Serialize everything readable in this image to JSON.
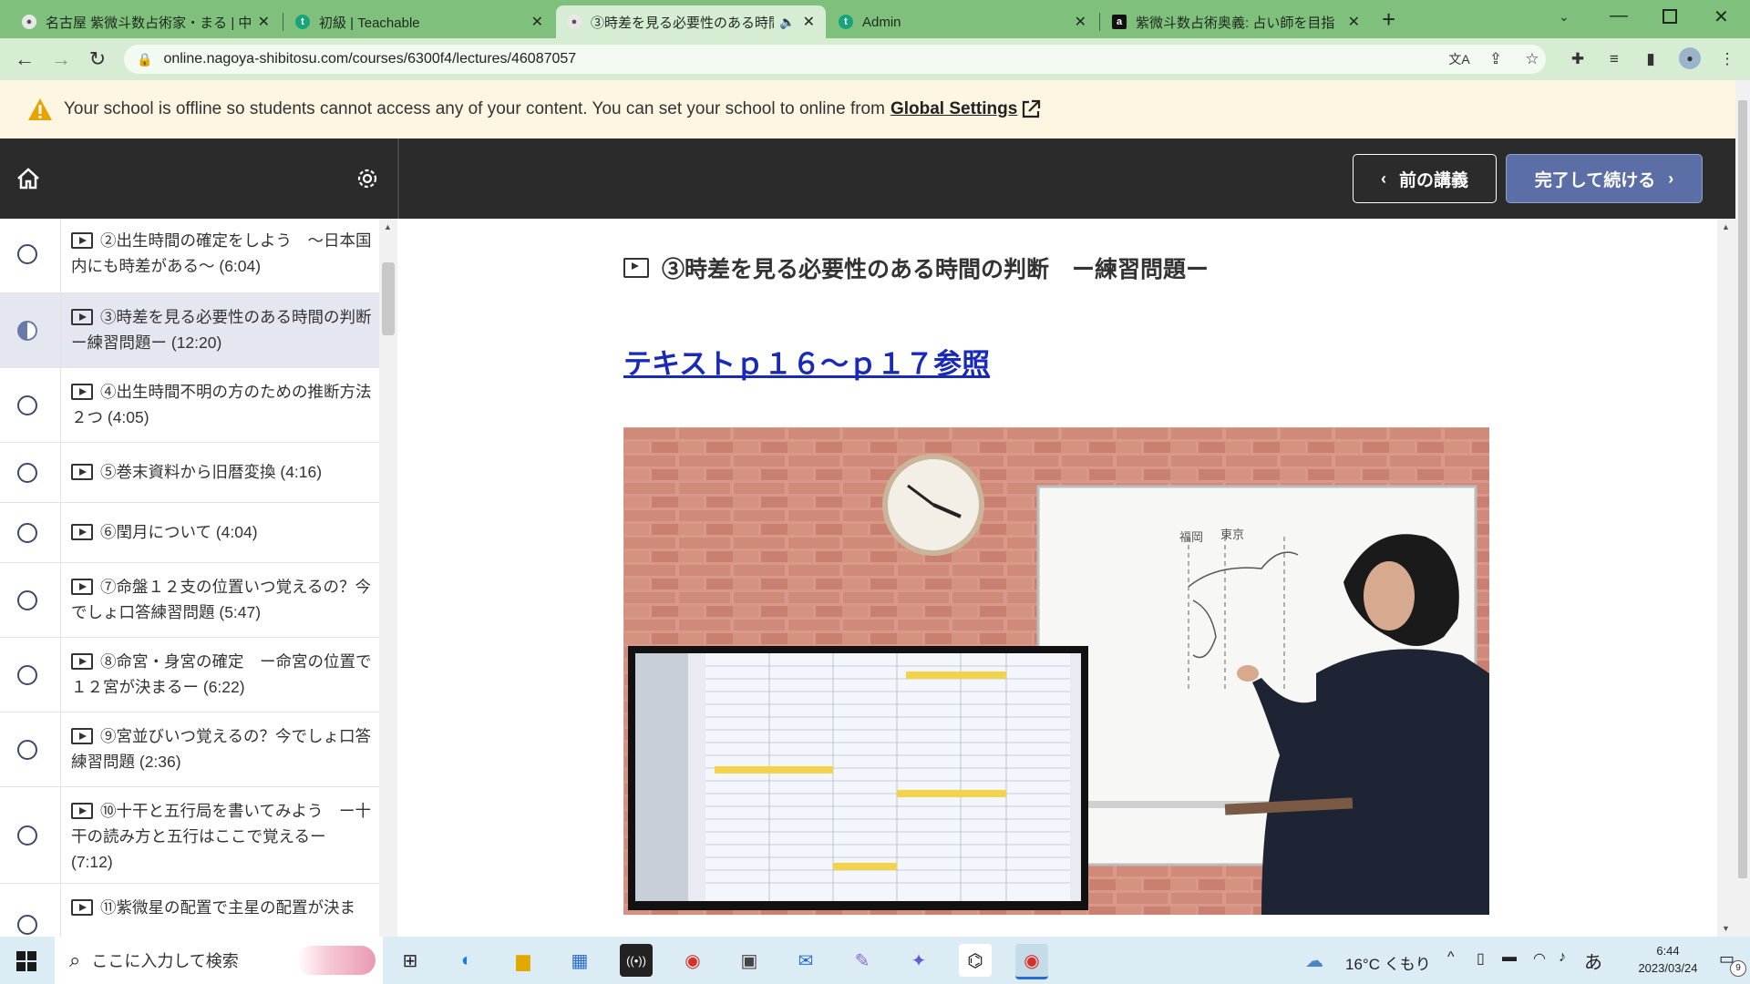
{
  "browser": {
    "tabs": [
      {
        "title": "名古屋 紫微斗数占術家・まる | 中",
        "favicon": "profile-icon",
        "active": false
      },
      {
        "title": "初級 | Teachable",
        "favicon": "t",
        "active": false
      },
      {
        "title": "③時差を見る必要性のある時間",
        "favicon": "profile-icon",
        "active": true,
        "audio": true
      },
      {
        "title": "Admin",
        "favicon": "t",
        "active": false
      },
      {
        "title": "紫微斗数占術奥義: 占い師を目指",
        "favicon": "a",
        "active": false
      }
    ],
    "new_tab_symbol": "+",
    "url": "online.nagoya-shibitosu.com/courses/6300f4/lectures/46087057"
  },
  "banner": {
    "message": "Your school is offline so students cannot access any of your content. You can set your school to online from ",
    "link": "Global Settings"
  },
  "header": {
    "prev_label": "前の講義",
    "next_label": "完了して続ける",
    "next_color": "#5b6fa6"
  },
  "sidebar": {
    "lectures": [
      {
        "title": "②出生時間の確定をしよう　～日本国内にも時差がある～ (6:04)",
        "status": "empty"
      },
      {
        "title": "③時差を見る必要性のある時間の判断　ー練習問題ー (12:20)",
        "status": "half"
      },
      {
        "title": "④出生時間不明の方のための推断方法２つ (4:05)",
        "status": "empty"
      },
      {
        "title": "⑤巻末資料から旧暦変換 (4:16)",
        "status": "empty"
      },
      {
        "title": "⑥閏月について (4:04)",
        "status": "empty"
      },
      {
        "title": "⑦命盤１２支の位置いつ覚えるの？今でしょ口答練習問題 (5:47)",
        "status": "empty"
      },
      {
        "title": "⑧命宮・身宮の確定　ー命宮の位置で１２宮が決まるー (6:22)",
        "status": "empty"
      },
      {
        "title": "⑨宮並びいつ覚えるの？今でしょ口答練習問題 (2:36)",
        "status": "empty"
      },
      {
        "title": "⑩十干と五行局を書いてみよう　ー十干の読み方と五行はここで覚えるー (7:12)",
        "status": "empty"
      },
      {
        "title": "⑪紫微星の配置で主星の配置が決ま",
        "status": "empty"
      }
    ]
  },
  "main": {
    "title": "③時差を見る必要性のある時間の判断　ー練習問題ー",
    "text_link": "テキストｐ１６～ｐ１７参照",
    "video": {
      "whiteboard_labels": [
        "福岡",
        "東京"
      ]
    }
  },
  "taskbar": {
    "search_placeholder": "ここに入力して検索",
    "weather": "16°C くもり",
    "ime": "あ",
    "time": "6:44",
    "date": "2023/03/24",
    "notification_count": "9"
  }
}
